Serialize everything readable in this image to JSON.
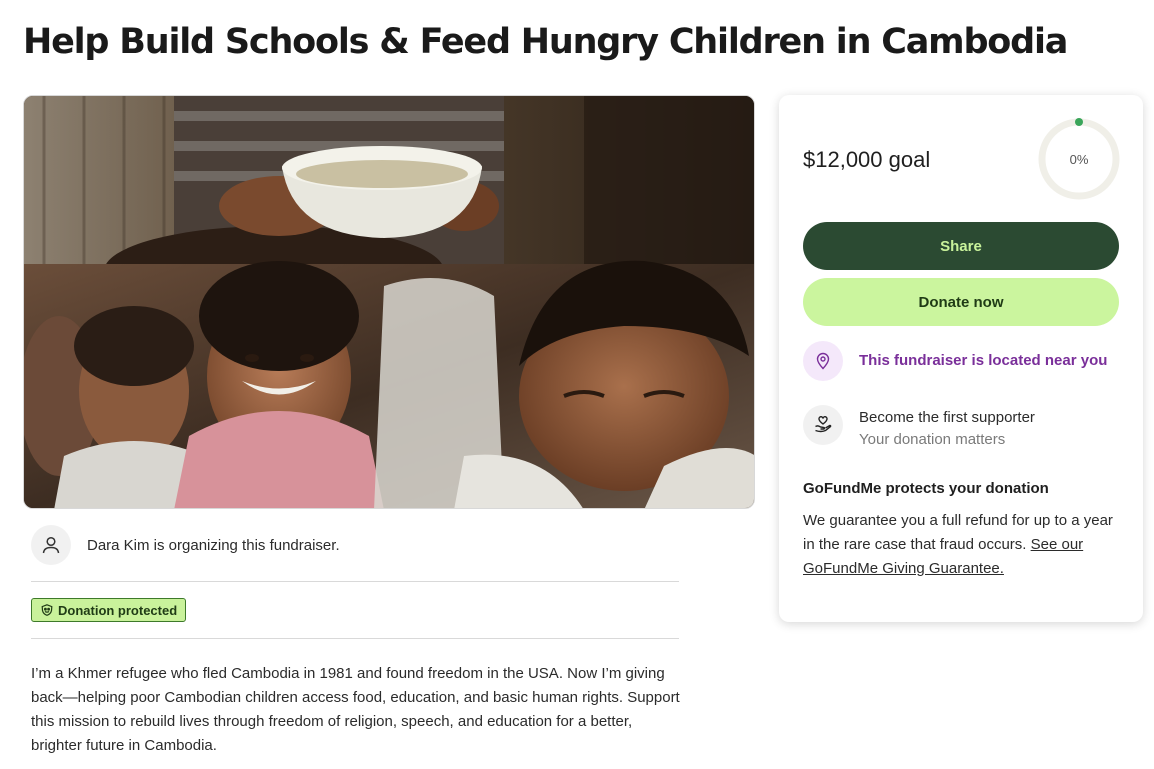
{
  "page": {
    "title": "Help Build Schools & Feed Hungry Children in Cambodia"
  },
  "organizer": {
    "text": "Dara Kim is organizing this fundraiser.",
    "icon": "user-icon"
  },
  "badge": {
    "label": "Donation protected",
    "icon": "shield-icon"
  },
  "story": {
    "text": "I’m a Khmer refugee who fled Cambodia in 1981 and found freedom in the USA. Now I’m giving back—helping poor Cambodian children access food, education, and basic human rights. Support this mission to rebuild lives through freedom of religion, speech, and education for a better, brighter future in Cambodia."
  },
  "card": {
    "goal": "$12,000 goal",
    "progress_label": "0%",
    "progress_value": 0,
    "share_label": "Share",
    "donate_label": "Donate now",
    "near_text": "This fundraiser is located near you",
    "near_icon": "location-pin-icon",
    "supporter_title": "Become the first supporter",
    "supporter_sub": "Your donation matters",
    "supporter_icon": "heart-hand-icon",
    "protect_heading": "GoFundMe protects your donation",
    "protect_body": "We guarantee you a full refund for up to a year in the rare case that fraud occurs.",
    "protect_link": "See our GoFundMe Giving Guarantee."
  },
  "colors": {
    "share_bg": "#2b4a32",
    "donate_bg": "#cbf59e",
    "accent_purple": "#7a2f9a",
    "progress_dot": "#3aa55a"
  }
}
